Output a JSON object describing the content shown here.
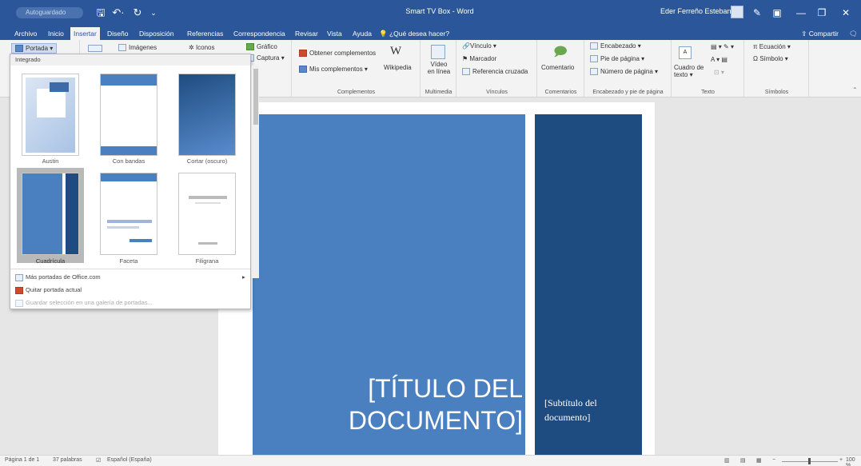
{
  "titlebar": {
    "autosave": "Autoguardado",
    "save_icon": "save-icon",
    "undo_icon": "undo-icon",
    "redo_icon": "redo-icon",
    "title": "Smart TV Box  -  Word",
    "user": "Eder Ferreño Esteban"
  },
  "tabs": [
    "Archivo",
    "Inicio",
    "Insertar",
    "Diseño",
    "Disposición",
    "Referencias",
    "Correspondencia",
    "Revisar",
    "Vista",
    "Ayuda"
  ],
  "tell_me": "¿Qué desea hacer?",
  "share": "Compartir",
  "ribbon": {
    "portada": "Portada",
    "imagenes": "Imágenes",
    "iconos": "Iconos",
    "grafico": "Gráfico",
    "captura": "Captura",
    "obtener_complementos": "Obtener complementos",
    "mis_complementos": "Mis complementos",
    "wikipedia": "Wikipedia",
    "complementos_group": "Complementos",
    "video_en_linea": "Vídeo en línea",
    "multimedia_group": "Multimedia",
    "vinculo": "Vínculo",
    "marcador": "Marcador",
    "referencia_cruzada": "Referencia cruzada",
    "vinculos_group": "Vínculos",
    "comentario": "Comentario",
    "comentarios_group": "Comentarios",
    "encabezado": "Encabezado",
    "pie_de_pagina": "Pie de página",
    "numero_de_pagina": "Número de página",
    "encabezado_group": "Encabezado y pie de página",
    "cuadro_de_texto": "Cuadro de texto",
    "texto_group": "Texto",
    "ecuacion": "Ecuación",
    "simbolo": "Símbolo",
    "simbolos_group": "Símbolos"
  },
  "gallery": {
    "header": "Integrado",
    "items": [
      "Austin",
      "Con bandas",
      "Cortar (oscuro)",
      "Cuadrícula",
      "Faceta",
      "Filigrana"
    ],
    "menu": [
      "Más portadas de Office.com",
      "Quitar portada actual",
      "Guardar selección en una galería de portadas..."
    ]
  },
  "document": {
    "title": "[TÍTULO DEL DOCUMENTO]",
    "subtitle": "[Subtítulo del documento]"
  },
  "statusbar": {
    "page": "Página 1 de 1",
    "words": "37 palabras",
    "language": "Español (España)",
    "zoom": "100 %"
  },
  "colors": {
    "word_blue": "#2b579a",
    "cover_light": "#4a7fc0",
    "cover_dark": "#1f4c80"
  }
}
